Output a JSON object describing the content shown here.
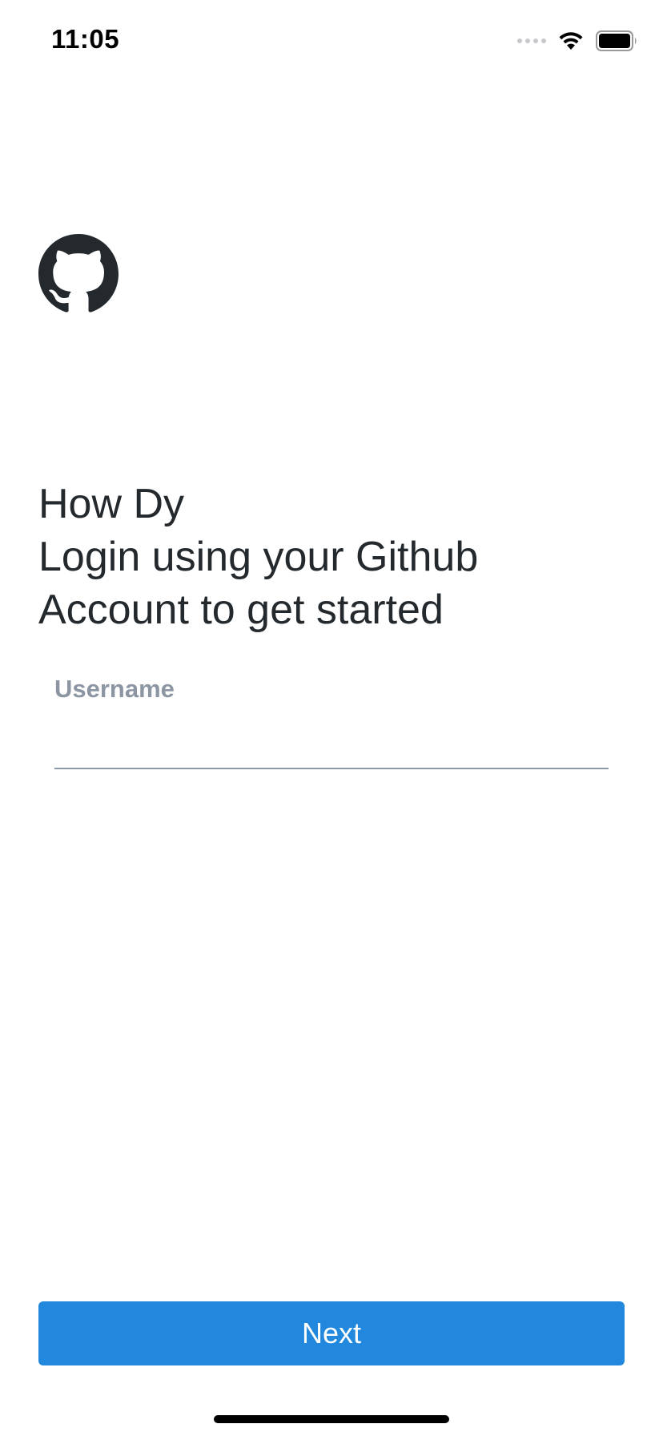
{
  "status_bar": {
    "time": "11:05",
    "signal_icon": "cellular-signal-icon",
    "wifi_icon": "wifi-icon",
    "battery_icon": "battery-icon"
  },
  "logo": {
    "icon": "github-octocat-icon",
    "color": "#24292e"
  },
  "heading": {
    "line1": "How Dy",
    "line2": "Login using your Github",
    "line3": "Account to get started"
  },
  "username_field": {
    "label": "Username",
    "value": "",
    "placeholder": ""
  },
  "next_button": {
    "label": "Next",
    "color": "#2188de"
  }
}
